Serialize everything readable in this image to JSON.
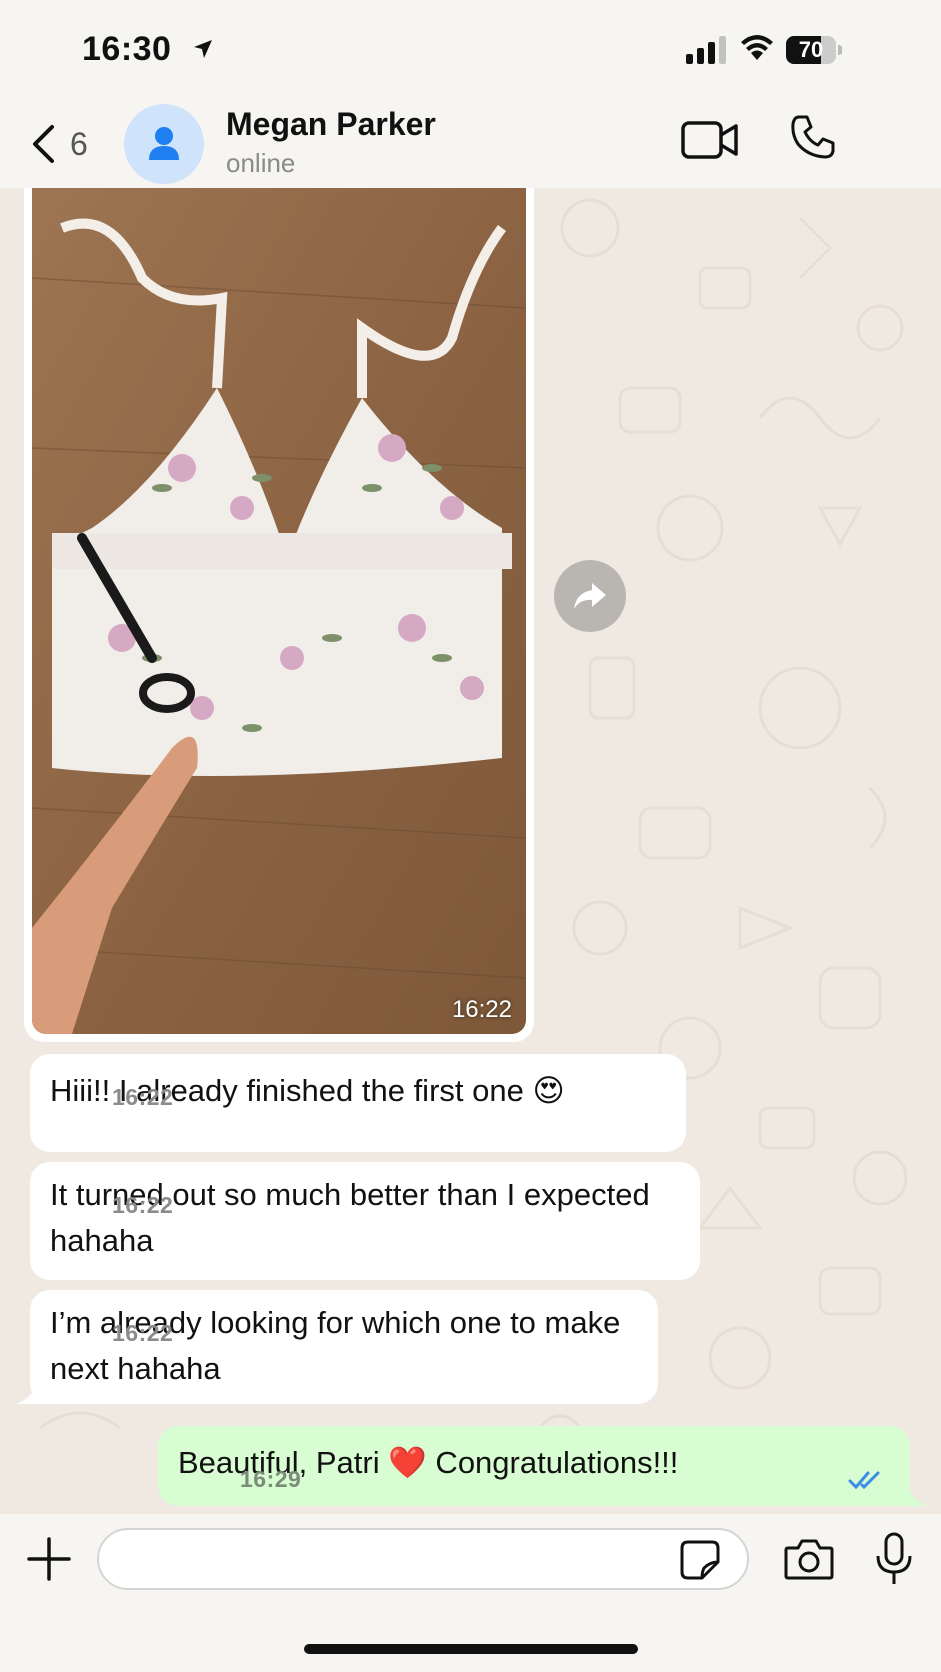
{
  "status_bar": {
    "time": "16:30",
    "battery": "70",
    "battery_level": 0.7
  },
  "header": {
    "back_count": "6",
    "contact_name": "Megan Parker",
    "contact_status": "online"
  },
  "messages": {
    "image_time": "16:22",
    "incoming": [
      {
        "text": "Hiii!! I already finished the first one 😍",
        "time": "16:22"
      },
      {
        "text": "It turned out so much better than I expected hahaha",
        "time": "16:22"
      },
      {
        "text": "I’m already looking for which one to make next hahaha",
        "time": "16:22"
      }
    ],
    "outgoing": {
      "text": "Beautiful, Patri ❤️ Congratulations!!!",
      "time": "16:29",
      "status": "read"
    }
  },
  "input": {
    "placeholder": ""
  },
  "colors": {
    "incoming_bubble": "#ffffff",
    "outgoing_bubble": "#d8fdd2",
    "read_ticks": "#3b8de8",
    "chat_background": "#efe9e2"
  },
  "icons": [
    "location-arrow-icon",
    "signal-icon",
    "wifi-icon",
    "battery-icon",
    "back-chevron-icon",
    "person-icon",
    "video-camera-icon",
    "phone-icon",
    "forward-icon",
    "double-check-icon",
    "plus-icon",
    "sticker-icon",
    "camera-icon",
    "microphone-icon"
  ]
}
